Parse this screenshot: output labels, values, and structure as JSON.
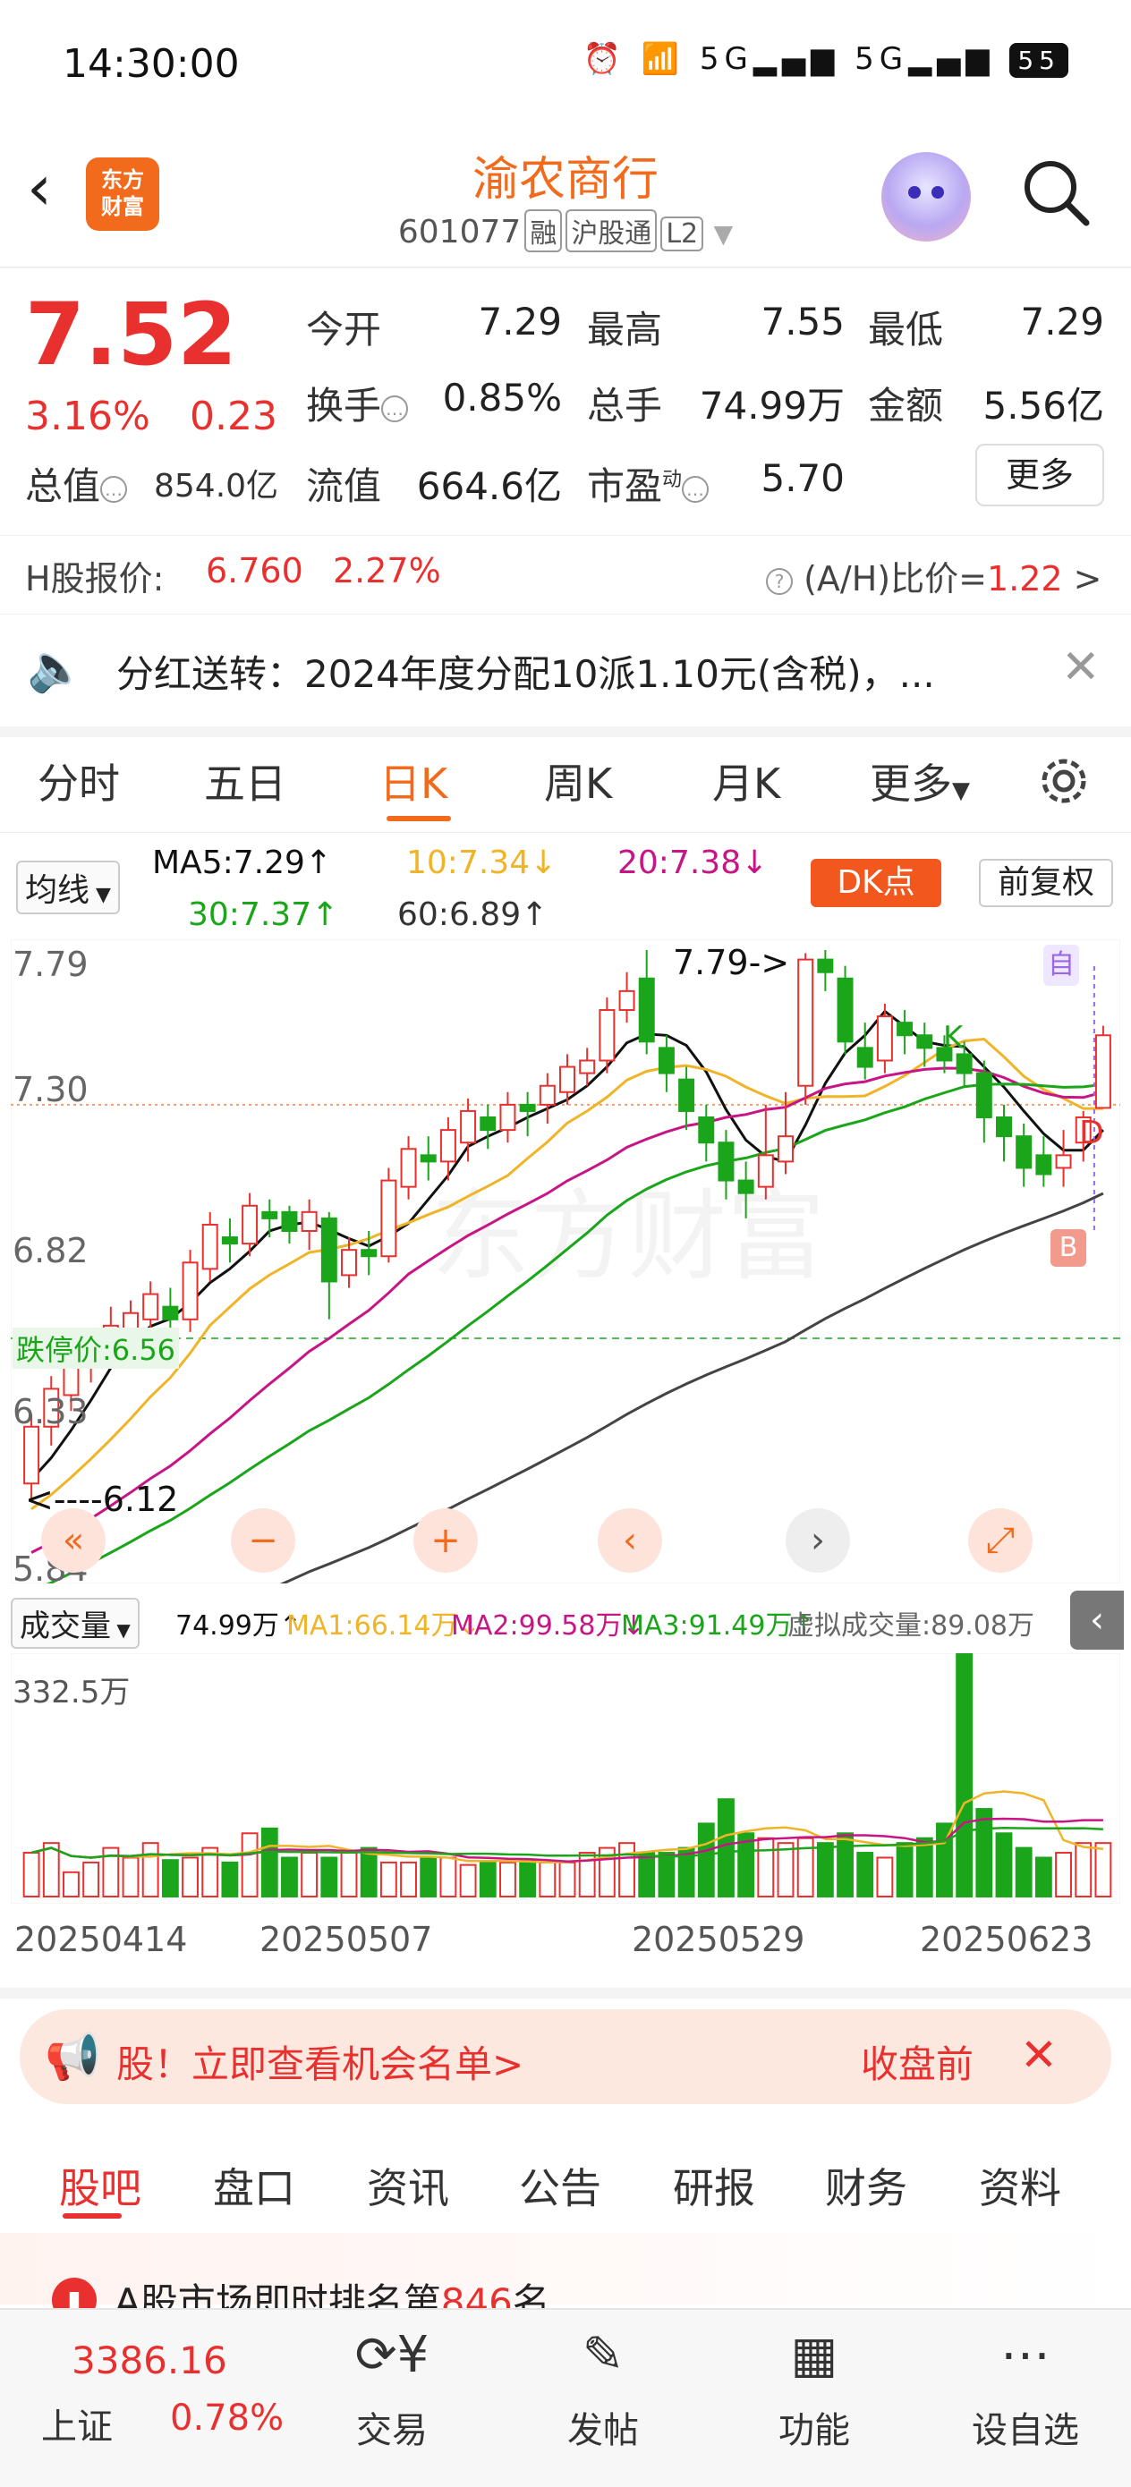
{
  "status_bar": {
    "time": "14:30:00",
    "battery": "55"
  },
  "header": {
    "title": "渝农商行",
    "code": "601077",
    "tags": [
      "融",
      "沪股通",
      "L2"
    ],
    "logo_text_1": "东方",
    "logo_text_2": "财富"
  },
  "quote": {
    "price": "7.52",
    "change_pct": "3.16%",
    "change_amt": "0.23",
    "open_label": "今开",
    "open": "7.29",
    "high_label": "最高",
    "high": "7.55",
    "low_label": "最低",
    "low": "7.29",
    "turnover_label": "换手",
    "turnover": "0.85%",
    "volume_label": "总手",
    "volume": "74.99万",
    "amount_label": "金额",
    "amount": "5.56亿",
    "mktcap_label": "总值",
    "mktcap": "854.0亿",
    "float_label": "流值",
    "float": "664.6亿",
    "pe_label": "市盈",
    "pe_sup": "动",
    "pe": "5.70",
    "more_label": "更多",
    "h_label": "H股报价:",
    "h_price": "6.760",
    "h_pct": "2.27%",
    "ah_label": "(A/H)比价=",
    "ah_value": "1.22"
  },
  "notice": {
    "text": "分红送转：2024年度分配10派1.10元(含税)，..."
  },
  "kline_tabs": [
    "分时",
    "五日",
    "日K",
    "周K",
    "月K",
    "更多"
  ],
  "active_tab": "日K",
  "chart_controls": {
    "ma_select": "均线",
    "ma5": "MA5:7.29",
    "ma10": "10:7.34",
    "ma20": "20:7.38",
    "ma30": "30:7.37",
    "ma60": "60:6.89",
    "dk_label": "DK点",
    "fq_label": "前复权"
  },
  "chart_labels": {
    "y_ticks": [
      "7.79",
      "7.30",
      "6.82",
      "6.33",
      "5.84"
    ],
    "high_marker": "7.79",
    "low_marker": "6.12",
    "limit_down": "跌停价:6.56",
    "watermark": "东方财富",
    "marker_zi": "自",
    "marker_k": "K",
    "marker_d": "D",
    "marker_b": "B"
  },
  "volume": {
    "select": "成交量",
    "current": "74.99万",
    "ma1": "MA1:66.14万",
    "ma2": "MA2:99.58万",
    "ma3": "MA3:91.49万",
    "virtual": "虚拟成交量:89.08万",
    "max_label": "332.5万",
    "dates": [
      "20250414",
      "20250507",
      "20250529",
      "20250623"
    ]
  },
  "banner": {
    "text": "股！立即查看机会名单>",
    "right": "收盘前"
  },
  "bottom_tabs": [
    "股吧",
    "盘口",
    "资讯",
    "公告",
    "研报",
    "财务",
    "资料"
  ],
  "rank_text": "A股市场即时排名第",
  "rank_num": "846",
  "rank_suffix": "名",
  "footer": {
    "index_value": "3386.16",
    "index_name": "上证",
    "index_pct": "0.78%",
    "items": [
      "交易",
      "发帖",
      "功能",
      "设自选"
    ]
  },
  "colors": {
    "up": "#e8312f",
    "down": "#1aa51a",
    "accent": "#f26b1d"
  },
  "chart_data": {
    "type": "candlestick",
    "y_range": [
      5.84,
      7.79
    ],
    "candles": [
      [
        6.1,
        6.28,
        6.05,
        6.32
      ],
      [
        6.28,
        6.4,
        6.22,
        6.44
      ],
      [
        6.38,
        6.5,
        6.33,
        6.55
      ],
      [
        6.48,
        6.55,
        6.42,
        6.58
      ],
      [
        6.52,
        6.6,
        6.48,
        6.66
      ],
      [
        6.58,
        6.64,
        6.52,
        6.68
      ],
      [
        6.62,
        6.7,
        6.56,
        6.74
      ],
      [
        6.66,
        6.62,
        6.56,
        6.72
      ],
      [
        6.62,
        6.8,
        6.58,
        6.84
      ],
      [
        6.78,
        6.92,
        6.74,
        6.96
      ],
      [
        6.88,
        6.86,
        6.8,
        6.94
      ],
      [
        6.86,
        6.98,
        6.82,
        7.02
      ],
      [
        6.96,
        6.94,
        6.88,
        7.0
      ],
      [
        6.96,
        6.9,
        6.86,
        6.98
      ],
      [
        6.9,
        6.96,
        6.84,
        7.0
      ],
      [
        6.94,
        6.74,
        6.62,
        6.96
      ],
      [
        6.76,
        6.84,
        6.72,
        6.88
      ],
      [
        6.84,
        6.82,
        6.76,
        6.9
      ],
      [
        6.82,
        7.06,
        6.8,
        7.1
      ],
      [
        7.04,
        7.16,
        7.0,
        7.2
      ],
      [
        7.14,
        7.12,
        7.06,
        7.2
      ],
      [
        7.12,
        7.22,
        7.06,
        7.26
      ],
      [
        7.18,
        7.28,
        7.12,
        7.32
      ],
      [
        7.26,
        7.22,
        7.16,
        7.3
      ],
      [
        7.22,
        7.3,
        7.18,
        7.34
      ],
      [
        7.3,
        7.28,
        7.2,
        7.34
      ],
      [
        7.3,
        7.36,
        7.24,
        7.4
      ],
      [
        7.34,
        7.42,
        7.3,
        7.46
      ],
      [
        7.4,
        7.44,
        7.36,
        7.48
      ],
      [
        7.44,
        7.6,
        7.4,
        7.64
      ],
      [
        7.6,
        7.66,
        7.56,
        7.72
      ],
      [
        7.7,
        7.5,
        7.46,
        7.79
      ],
      [
        7.48,
        7.4,
        7.34,
        7.52
      ],
      [
        7.38,
        7.28,
        7.22,
        7.42
      ],
      [
        7.26,
        7.18,
        7.12,
        7.3
      ],
      [
        7.18,
        7.06,
        7.0,
        7.22
      ],
      [
        7.06,
        7.02,
        6.94,
        7.12
      ],
      [
        7.04,
        7.14,
        7.0,
        7.3
      ],
      [
        7.12,
        7.2,
        7.08,
        7.34
      ],
      [
        7.36,
        7.76,
        7.3,
        7.78
      ],
      [
        7.76,
        7.72,
        7.66,
        7.79
      ],
      [
        7.7,
        7.5,
        7.46,
        7.74
      ],
      [
        7.48,
        7.42,
        7.38,
        7.56
      ],
      [
        7.44,
        7.58,
        7.4,
        7.62
      ],
      [
        7.56,
        7.52,
        7.46,
        7.6
      ],
      [
        7.52,
        7.48,
        7.42,
        7.56
      ],
      [
        7.48,
        7.44,
        7.4,
        7.52
      ],
      [
        7.46,
        7.4,
        7.36,
        7.5
      ],
      [
        7.4,
        7.26,
        7.18,
        7.44
      ],
      [
        7.26,
        7.2,
        7.12,
        7.3
      ],
      [
        7.2,
        7.1,
        7.04,
        7.24
      ],
      [
        7.14,
        7.08,
        7.04,
        7.2
      ],
      [
        7.1,
        7.14,
        7.04,
        7.22
      ],
      [
        7.18,
        7.26,
        7.12,
        7.28
      ],
      [
        7.29,
        7.52,
        7.29,
        7.55
      ]
    ],
    "volumes": [
      0.18,
      0.22,
      0.1,
      0.14,
      0.2,
      0.16,
      0.22,
      0.15,
      0.16,
      0.2,
      0.14,
      0.26,
      0.28,
      0.16,
      0.18,
      0.16,
      0.18,
      0.2,
      0.14,
      0.14,
      0.16,
      0.16,
      0.13,
      0.14,
      0.14,
      0.15,
      0.14,
      0.14,
      0.18,
      0.2,
      0.22,
      0.18,
      0.18,
      0.2,
      0.3,
      0.4,
      0.26,
      0.24,
      0.22,
      0.24,
      0.22,
      0.26,
      0.18,
      0.16,
      0.22,
      0.24,
      0.3,
      1.0,
      0.36,
      0.26,
      0.2,
      0.16,
      0.18,
      0.22,
      0.22
    ]
  }
}
